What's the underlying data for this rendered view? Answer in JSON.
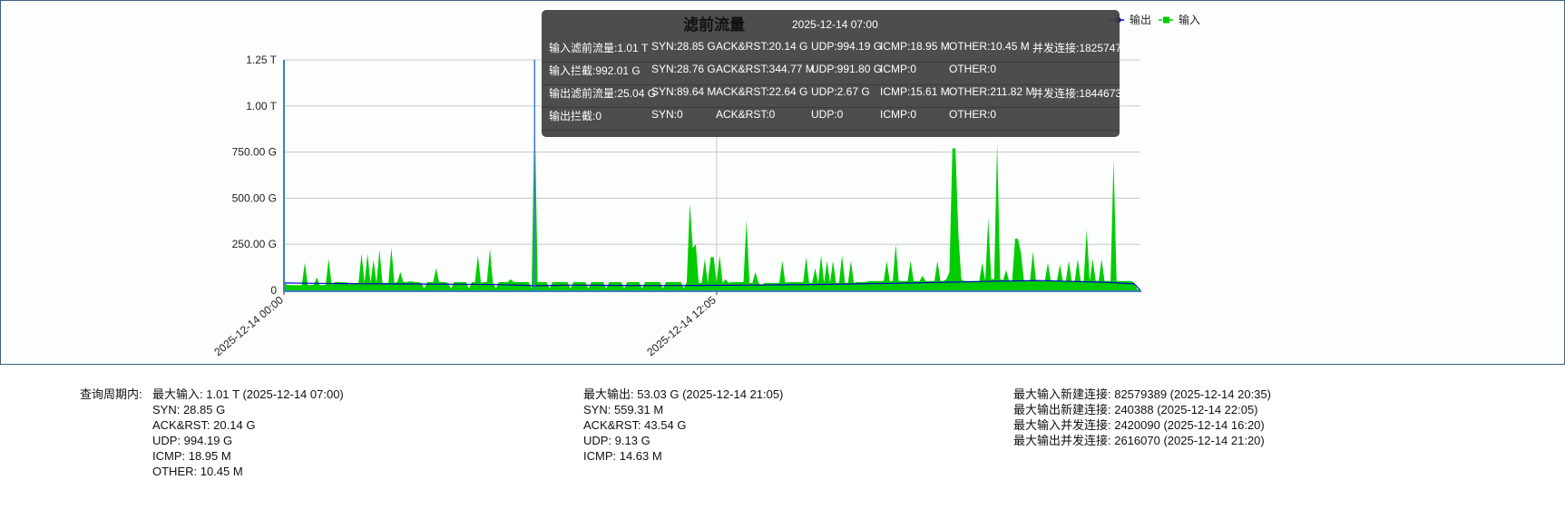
{
  "chart_data": {
    "type": "area",
    "title": "滤前流量",
    "yticks": [
      "0",
      "250.00 G",
      "500.00 G",
      "750.00 G",
      "1.00 T",
      "1.25 T"
    ],
    "ylim_G": [
      0,
      1250
    ],
    "xticks": [
      "2025-12-14 00:00",
      "2025-12-14 12:05"
    ],
    "x_start": "2025-12-14 00:00",
    "x_step_minutes": 5,
    "grid": true,
    "legend_position": "top-right",
    "colors": {
      "输出": "#0000cc",
      "输入": "#00cc00",
      "crosshair": "#3b7fc4"
    },
    "crosshair_time": "2025-12-14 07:00",
    "series": [
      {
        "name": "输入",
        "unit": "G",
        "values": [
          40,
          30,
          28,
          28,
          28,
          28,
          28,
          150,
          28,
          28,
          30,
          70,
          28,
          28,
          30,
          170,
          30,
          45,
          45,
          45,
          44,
          44,
          30,
          40,
          40,
          40,
          200,
          40,
          200,
          40,
          165,
          40,
          220,
          40,
          40,
          40,
          230,
          40,
          45,
          100,
          45,
          45,
          48,
          48,
          45,
          45,
          40,
          10,
          45,
          45,
          45,
          120,
          45,
          45,
          45,
          40,
          10,
          45,
          45,
          45,
          45,
          45,
          10,
          45,
          45,
          190,
          40,
          45,
          45,
          225,
          45,
          10,
          45,
          45,
          45,
          45,
          60,
          45,
          45,
          45,
          45,
          45,
          45,
          10,
          1010,
          45,
          45,
          45,
          45,
          10,
          45,
          45,
          45,
          45,
          45,
          45,
          10,
          45,
          45,
          45,
          45,
          45,
          10,
          45,
          45,
          45,
          45,
          45,
          10,
          45,
          45,
          45,
          45,
          45,
          10,
          45,
          45,
          45,
          45,
          45,
          10,
          45,
          45,
          45,
          45,
          45,
          45,
          10,
          45,
          45,
          45,
          45,
          45,
          45,
          10,
          45,
          470,
          230,
          250,
          40,
          40,
          170,
          40,
          180,
          180,
          40,
          190,
          40,
          60,
          40,
          45,
          45,
          45,
          45,
          45,
          380,
          40,
          40,
          100,
          40,
          30,
          40,
          40,
          40,
          40,
          40,
          40,
          160,
          40,
          45,
          45,
          45,
          45,
          45,
          45,
          180,
          40,
          40,
          120,
          40,
          190,
          40,
          160,
          40,
          160,
          40,
          40,
          190,
          40,
          40,
          160,
          40,
          45,
          45,
          45,
          45,
          50,
          50,
          50,
          50,
          50,
          50,
          160,
          50,
          50,
          250,
          50,
          50,
          50,
          50,
          160,
          50,
          50,
          50,
          80,
          50,
          50,
          50,
          50,
          160,
          50,
          50,
          60,
          100,
          770,
          770,
          300,
          60,
          50,
          50,
          50,
          50,
          50,
          50,
          150,
          50,
          390,
          60,
          60,
          800,
          60,
          55,
          110,
          50,
          50,
          280,
          280,
          200,
          50,
          50,
          50,
          210,
          50,
          50,
          50,
          50,
          150,
          50,
          50,
          50,
          140,
          50,
          50,
          160,
          50,
          50,
          170,
          50,
          50,
          330,
          50,
          170,
          50,
          50,
          170,
          50,
          50,
          50,
          710,
          50,
          50,
          50,
          50,
          50,
          50,
          40,
          5,
          0
        ]
      },
      {
        "name": "输出",
        "unit": "G",
        "times": [
          "00:00",
          "01:00",
          "02:00",
          "03:00",
          "04:00",
          "05:00",
          "06:00",
          "07:00",
          "08:00",
          "09:00",
          "10:00",
          "11:00",
          "12:00",
          "13:00",
          "14:00",
          "15:00",
          "16:00",
          "17:00",
          "18:00",
          "19:00",
          "20:00",
          "21:05",
          "22:00",
          "23:00",
          "23:45",
          "23:55"
        ],
        "values": [
          40,
          38,
          36,
          35,
          34,
          33,
          31,
          25,
          28,
          27,
          26,
          26,
          27,
          28,
          30,
          32,
          35,
          38,
          42,
          46,
          50,
          53,
          48,
          44,
          35,
          0
        ]
      }
    ]
  },
  "tooltip": {
    "title": "滤前流量",
    "time": "2025-12-14 07:00",
    "rows": [
      [
        "输入滤前流量:1.01 T",
        "SYN:28.85 G",
        "ACK&RST:20.14 G",
        "UDP:994.19 G",
        "ICMP:18.95 M",
        "OTHER:10.45 M",
        "并发连接:1825747"
      ],
      [
        "输入拦截:992.01 G",
        "SYN:28.76 G",
        "ACK&RST:344.77 M",
        "UDP:991.80 G",
        "ICMP:0",
        "OTHER:0",
        ""
      ],
      [
        "输出滤前流量:25.04 G",
        "SYN:89.64 M",
        "ACK&RST:22.64 G",
        "UDP:2.67 G",
        "ICMP:15.61 M",
        "OTHER:211.82 M",
        "并发连接:1844673"
      ],
      [
        "输出拦截:0",
        "SYN:0",
        "ACK&RST:0",
        "UDP:0",
        "ICMP:0",
        "OTHER:0",
        ""
      ]
    ]
  },
  "legend": {
    "output": "输出",
    "input": "输入"
  },
  "stats": {
    "label": "查询周期内:",
    "col1": [
      "最大输入: 1.01 T (2025-12-14 07:00)",
      "SYN: 28.85 G",
      "ACK&RST: 20.14 G",
      "UDP: 994.19 G",
      "ICMP: 18.95 M",
      "OTHER: 10.45 M"
    ],
    "col2": [
      "最大输出: 53.03 G (2025-12-14 21:05)",
      "SYN: 559.31 M",
      "ACK&RST: 43.54 G",
      "UDP: 9.13 G",
      "ICMP: 14.63 M"
    ],
    "col3": [
      "最大输入新建连接: 82579389 (2025-12-14 20:35)",
      "最大输出新建连接: 240388 (2025-12-14 22:05)",
      "最大输入并发连接: 2420090 (2025-12-14 16:20)",
      "最大输出并发连接: 2616070 (2025-12-14 21:20)"
    ]
  }
}
